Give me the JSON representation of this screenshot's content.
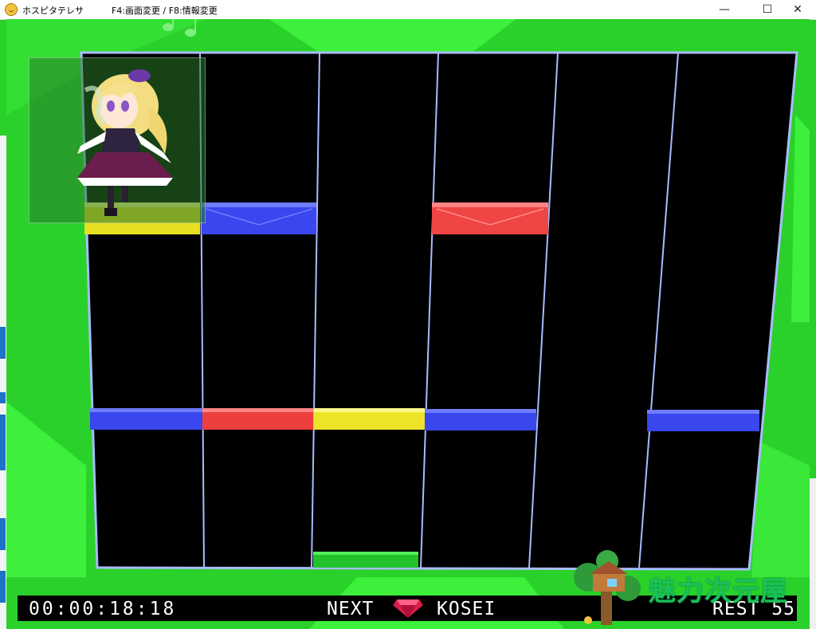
{
  "window": {
    "title": "ホスピタテレサ",
    "hotkeys": "F4:画面変更 / F8:情報変更",
    "minimize": "—",
    "maximize": "☐",
    "close": "✕"
  },
  "hud": {
    "timer": "00:00:18:18",
    "next_label": "NEXT",
    "next_piece": "KOSEI",
    "rest_label": "REST",
    "rest_count": "55"
  },
  "watermark": {
    "text": "魅力次元屋"
  },
  "colors": {
    "green_bg": "#2ed32e",
    "light_green": "#39ee39",
    "board_border": "#9fb6ff",
    "block_blue": "#3340e8",
    "block_red": "#ee3a3a",
    "block_yellow": "#f2e82a",
    "block_green": "#22c02a"
  },
  "board": {
    "columns": 6,
    "blocks": [
      {
        "column": 1,
        "row": "top",
        "color": "yellow"
      },
      {
        "column": 2,
        "row": "top",
        "color": "blue"
      },
      {
        "column": 4,
        "row": "top",
        "color": "red"
      },
      {
        "column": 1,
        "row": "middle",
        "color": "blue"
      },
      {
        "column": 2,
        "row": "middle",
        "color": "red"
      },
      {
        "column": 3,
        "row": "middle",
        "color": "yellow"
      },
      {
        "column": 4,
        "row": "middle",
        "color": "blue"
      },
      {
        "column": 6,
        "row": "middle",
        "color": "blue"
      },
      {
        "column": 3,
        "row": "bottom",
        "color": "green"
      }
    ]
  },
  "icons": {
    "app": "app-face-icon",
    "gem": "gem-icon",
    "music_note": "music-note-icon",
    "character": "character-sprite",
    "tree_logo": "treehouse-logo"
  }
}
